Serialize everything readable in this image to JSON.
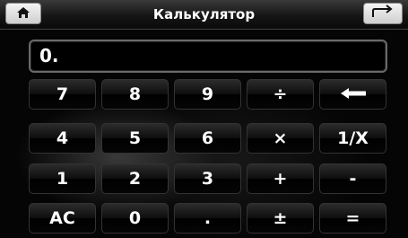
{
  "app": {
    "title": "Калькулятор"
  },
  "titlebar": {
    "home_icon": "home-icon",
    "back_icon": "return-arrow-icon"
  },
  "display": {
    "value": "0."
  },
  "keypad": {
    "rows": [
      [
        "7",
        "8",
        "9",
        "÷",
        "←"
      ],
      [
        "4",
        "5",
        "6",
        "×",
        "1/X"
      ],
      [
        "1",
        "2",
        "3",
        "+",
        "-"
      ],
      [
        "AC",
        "0",
        ".",
        "±",
        "="
      ]
    ],
    "icons": {
      "backspace": "left-arrow-icon"
    }
  },
  "colors": {
    "background": "#050505",
    "text": "#ffffff",
    "titlebar_button": "#e8e8e8"
  }
}
